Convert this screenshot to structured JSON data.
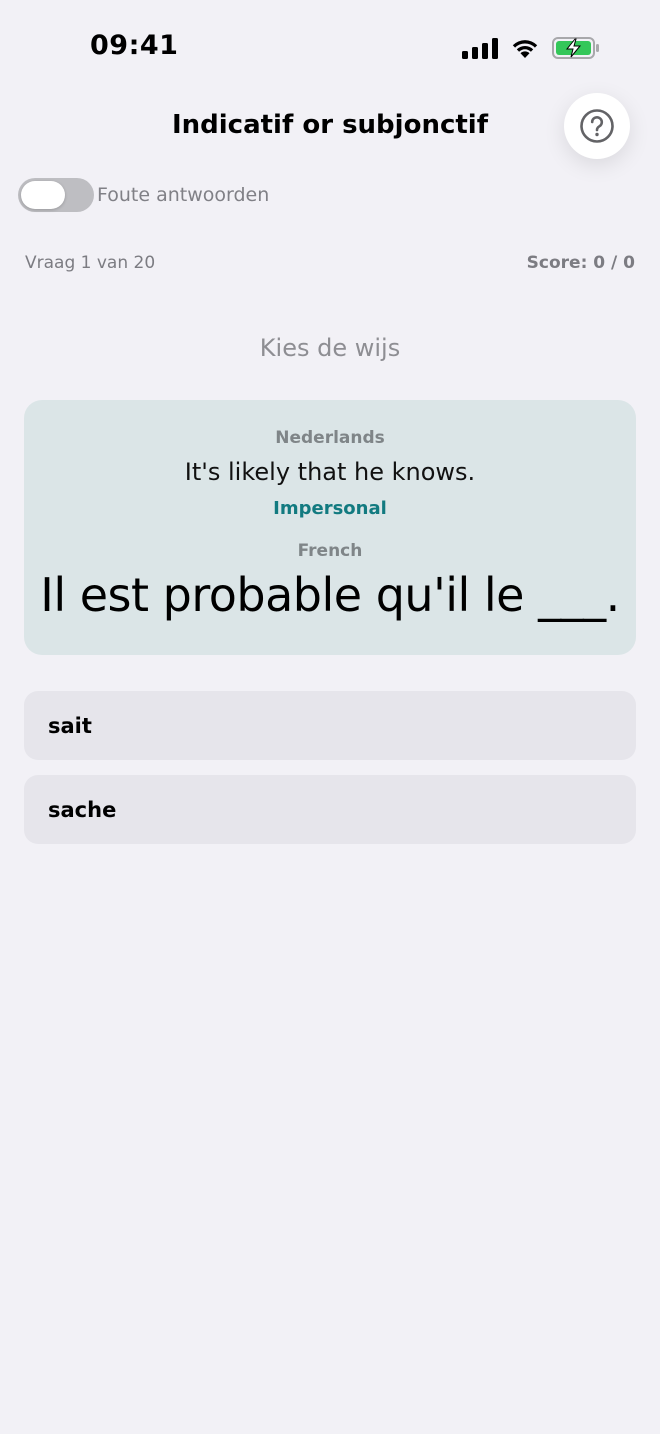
{
  "status_bar": {
    "time": "09:41"
  },
  "header": {
    "title": "Indicatif or subjonctif",
    "help_icon": "question-circle-icon"
  },
  "toggle": {
    "label": "Foute antwoorden",
    "on": false
  },
  "progress": {
    "question_text": "Vraag 1 van 20",
    "score_text": "Score: 0 / 0"
  },
  "instruction": "Kies de wijs",
  "card": {
    "source_label": "Nederlands",
    "translation": "It's likely that he knows.",
    "tag": "Impersonal",
    "target_label": "French",
    "sentence": "Il est probable qu'il le ___."
  },
  "options": [
    {
      "label": "sait"
    },
    {
      "label": "sache"
    }
  ],
  "colors": {
    "background": "#f2f1f6",
    "card": "#dbe5e7",
    "tag": "#127a80",
    "option": "#e6e5eb",
    "battery_green": "#34c759"
  }
}
